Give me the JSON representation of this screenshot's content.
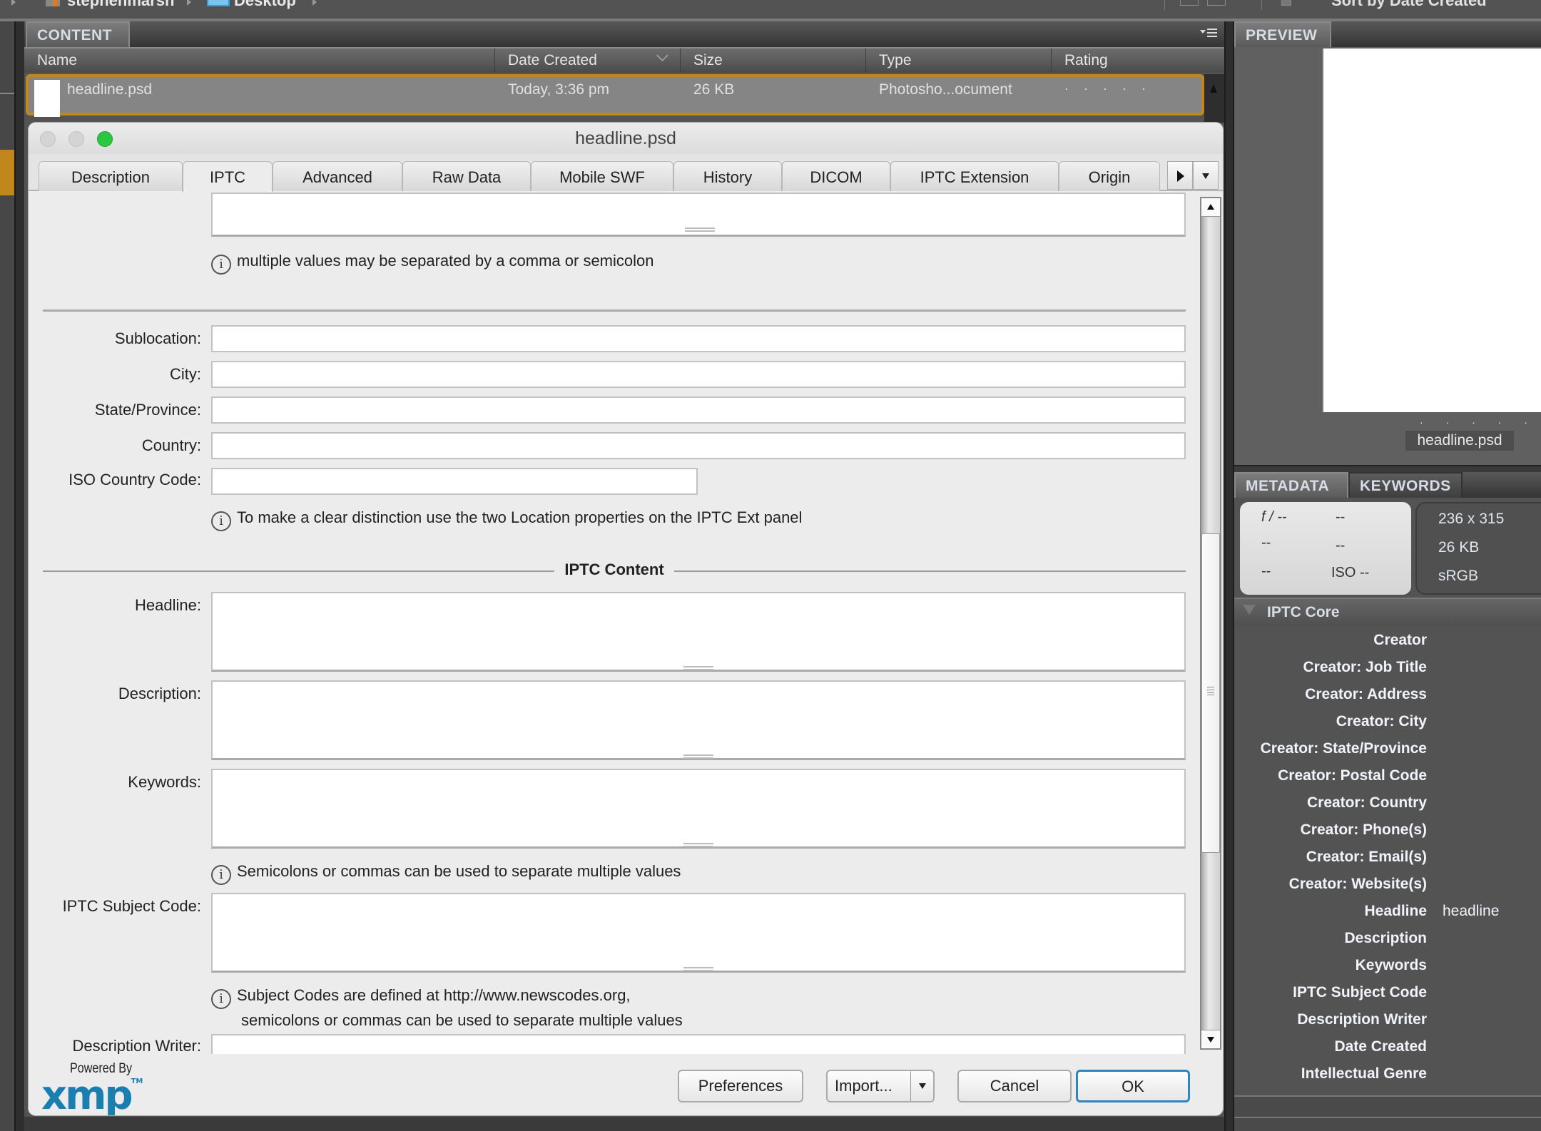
{
  "path_bar": {
    "crumbs": [
      "stephenmarsh",
      "Desktop"
    ],
    "sort_label": "Sort by Date Created"
  },
  "content_panel": {
    "tab_label": "CONTENT",
    "columns": [
      "Name",
      "Date Created",
      "Size",
      "Type",
      "Rating"
    ],
    "files": [
      {
        "name": "headline.psd",
        "date_created": "Today, 3:36 pm",
        "size": "26 KB",
        "type": "Photosho...ocument",
        "rating": "· · · · ·"
      }
    ]
  },
  "preview_panel": {
    "tab_label": "PREVIEW",
    "rating_dots": "· · · · ·",
    "filename": "headline.psd"
  },
  "metadata_panel": {
    "tabs": [
      "METADATA",
      "KEYWORDS"
    ],
    "camera": {
      "aperture": "f / --",
      "shutter": "--",
      "exposure_comp": "--",
      "focal": "--",
      "white_balance": "--",
      "iso": "ISO --"
    },
    "file_info": {
      "dimensions": "236 x 315",
      "size": "26 KB",
      "color_space": "sRGB"
    },
    "section_title": "IPTC Core",
    "fields": [
      {
        "key": "Creator",
        "value": ""
      },
      {
        "key": "Creator: Job Title",
        "value": ""
      },
      {
        "key": "Creator: Address",
        "value": ""
      },
      {
        "key": "Creator: City",
        "value": ""
      },
      {
        "key": "Creator: State/Province",
        "value": ""
      },
      {
        "key": "Creator: Postal Code",
        "value": ""
      },
      {
        "key": "Creator: Country",
        "value": ""
      },
      {
        "key": "Creator: Phone(s)",
        "value": ""
      },
      {
        "key": "Creator: Email(s)",
        "value": ""
      },
      {
        "key": "Creator: Website(s)",
        "value": ""
      },
      {
        "key": "Headline",
        "value": "headline"
      },
      {
        "key": "Description",
        "value": ""
      },
      {
        "key": "Keywords",
        "value": ""
      },
      {
        "key": "IPTC Subject Code",
        "value": ""
      },
      {
        "key": "Description Writer",
        "value": ""
      },
      {
        "key": "Date Created",
        "value": ""
      },
      {
        "key": "Intellectual Genre",
        "value": ""
      }
    ]
  },
  "dialog": {
    "title": "headline.psd",
    "tabs": [
      "Description",
      "IPTC",
      "Advanced",
      "Raw Data",
      "Mobile SWF",
      "History",
      "DICOM",
      "IPTC Extension",
      "Origin"
    ],
    "active_tab": "IPTC",
    "hints": {
      "multiple_values": "multiple values may be separated by a comma or semicolon",
      "location": "To make a clear distinction use the two Location properties on the IPTC Ext panel",
      "separators": "Semicolons or commas can be used to separate multiple values",
      "subject_codes_line1": "Subject Codes are defined at http://www.newscodes.org,",
      "subject_codes_line2": "semicolons or commas can be used to separate multiple values"
    },
    "location_fields": [
      {
        "label": "Sublocation:",
        "value": ""
      },
      {
        "label": "City:",
        "value": ""
      },
      {
        "label": "State/Province:",
        "value": ""
      },
      {
        "label": "Country:",
        "value": ""
      },
      {
        "label": "ISO Country Code:",
        "value": ""
      }
    ],
    "section_iptc_content": "IPTC Content",
    "content_fields": [
      {
        "label": "Headline:",
        "value": ""
      },
      {
        "label": "Description:",
        "value": ""
      },
      {
        "label": "Keywords:",
        "value": ""
      },
      {
        "label": "IPTC Subject Code:",
        "value": ""
      },
      {
        "label": "Description Writer:",
        "value": ""
      }
    ],
    "powered_by": "Powered By",
    "logo": "xmp",
    "buttons": {
      "preferences": "Preferences",
      "import": "Import...",
      "cancel": "Cancel",
      "ok": "OK"
    },
    "colors": {
      "accent": "#2e86c1",
      "logo": "#1a7fb0",
      "selection": "#c0871c"
    }
  }
}
